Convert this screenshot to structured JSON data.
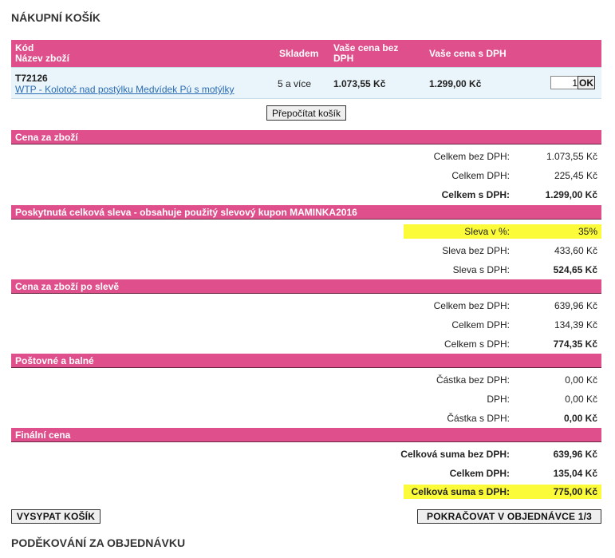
{
  "page_title": "NÁKUPNÍ KOŠÍK",
  "table_header": {
    "code": "Kód",
    "name": "Název zboží",
    "stock": "Skladem",
    "price_no_vat": "Vaše cena bez DPH",
    "price_vat": "Vaše cena s DPH"
  },
  "item": {
    "code": "T72126",
    "name": "WTP - Kolotoč nad postýlku Medvídek Pú s motýlky",
    "stock": "5 a více",
    "price_no_vat": "1.073,55 Kč",
    "price_vat": "1.299,00 Kč",
    "quantity": "1",
    "ok_label": "OK"
  },
  "recalc_label": "Přepočítat košík",
  "sections": {
    "goods": {
      "title": "Cena za zboží",
      "rows": [
        {
          "label": "Celkem bez DPH:",
          "value": "1.073,55 Kč"
        },
        {
          "label": "Celkem DPH:",
          "value": "225,45 Kč"
        },
        {
          "label": "Celkem s DPH:",
          "value": "1.299,00 Kč"
        }
      ]
    },
    "discount": {
      "title": "Poskytnutá celková sleva - obsahuje použitý slevový kupon MAMINKA2016",
      "rows": [
        {
          "label": "Sleva v %:",
          "value": "35%"
        },
        {
          "label": "Sleva bez DPH:",
          "value": "433,60 Kč"
        },
        {
          "label": "Sleva s DPH:",
          "value": "524,65 Kč"
        }
      ]
    },
    "after_discount": {
      "title": "Cena za zboží po slevě",
      "rows": [
        {
          "label": "Celkem bez DPH:",
          "value": "639,96 Kč"
        },
        {
          "label": "Celkem DPH:",
          "value": "134,39 Kč"
        },
        {
          "label": "Celkem s DPH:",
          "value": "774,35 Kč"
        }
      ]
    },
    "shipping": {
      "title": "Poštovné a balné",
      "rows": [
        {
          "label": "Částka bez DPH:",
          "value": "0,00 Kč"
        },
        {
          "label": "DPH:",
          "value": "0,00 Kč"
        },
        {
          "label": "Částka s DPH:",
          "value": "0,00 Kč"
        }
      ]
    },
    "final": {
      "title": "Finální cena",
      "rows": [
        {
          "label": "Celková suma bez DPH:",
          "value": "639,96 Kč"
        },
        {
          "label": "Celkem DPH:",
          "value": "135,04 Kč"
        },
        {
          "label": "Celková suma s DPH:",
          "value": "775,00 Kč"
        }
      ]
    }
  },
  "buttons": {
    "empty_cart": "VYSYPAT KOŠÍK",
    "continue": "POKRAČOVAT V OBJEDNÁVCE 1/3"
  },
  "footer_title": "PODĚKOVÁNÍ ZA OBJEDNÁVKU",
  "colors": {
    "section_bar": "#df4f8c",
    "item_row": "#e9f4fb",
    "highlight": "#fbfb3a",
    "link": "#2a6cb2"
  }
}
